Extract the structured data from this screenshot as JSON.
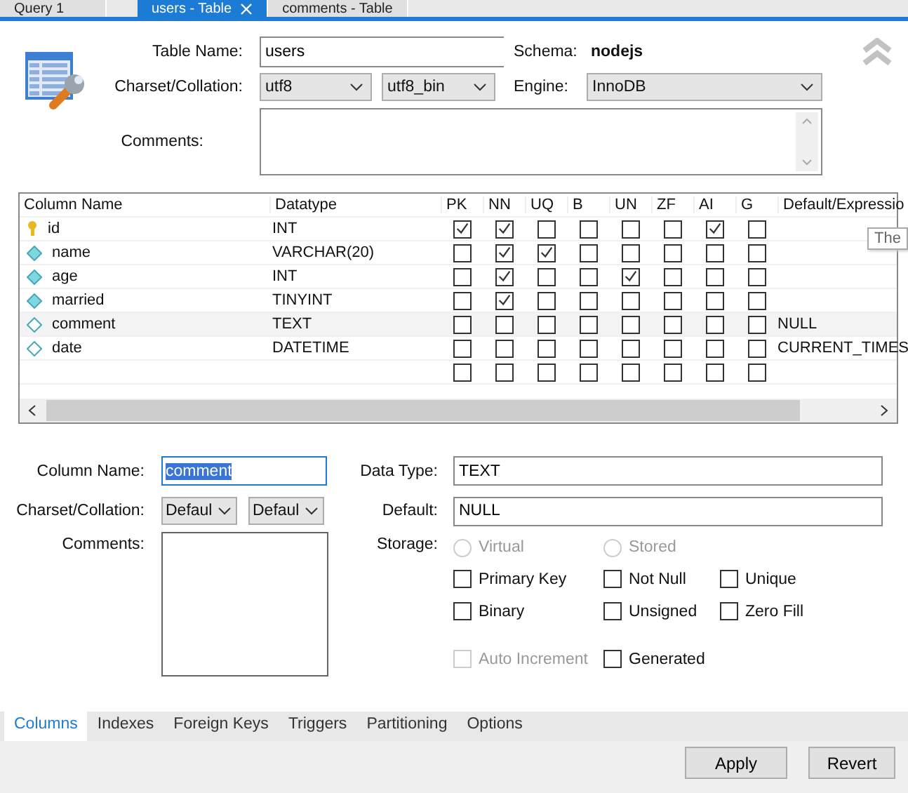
{
  "tabs": [
    {
      "label": "Query 1",
      "selected": false,
      "closable": false
    },
    {
      "label": "users - Table",
      "selected": true,
      "closable": true
    },
    {
      "label": "comments - Table",
      "selected": false,
      "closable": false
    }
  ],
  "table_form": {
    "table_name_label": "Table Name:",
    "table_name": "users",
    "schema_label": "Schema:",
    "schema": "nodejs",
    "charset_label": "Charset/Collation:",
    "charset": "utf8",
    "collation": "utf8_bin",
    "engine_label": "Engine:",
    "engine": "InnoDB",
    "comments_label": "Comments:"
  },
  "grid": {
    "columns": [
      "Column Name",
      "Datatype",
      "PK",
      "NN",
      "UQ",
      "B",
      "UN",
      "ZF",
      "AI",
      "G",
      "Default/Expressio"
    ],
    "rows": [
      {
        "kind": "key",
        "name": "id",
        "datatype": "INT",
        "flags": [
          true,
          true,
          false,
          false,
          false,
          false,
          true,
          false
        ],
        "selected": false
      },
      {
        "kind": "required",
        "name": "name",
        "datatype": "VARCHAR(20)",
        "flags": [
          false,
          true,
          true,
          false,
          false,
          false,
          false,
          false
        ],
        "selected": false
      },
      {
        "kind": "required",
        "name": "age",
        "datatype": "INT",
        "flags": [
          false,
          true,
          false,
          false,
          true,
          false,
          false,
          false
        ],
        "selected": false
      },
      {
        "kind": "required",
        "name": "married",
        "datatype": "TINYINT",
        "flags": [
          false,
          true,
          false,
          false,
          false,
          false,
          false,
          false
        ],
        "selected": false
      },
      {
        "kind": "optional",
        "name": "comment",
        "datatype": "TEXT",
        "flags": [
          false,
          false,
          false,
          false,
          false,
          false,
          false,
          false
        ],
        "default": "NULL",
        "selected": true
      },
      {
        "kind": "optional",
        "name": "date",
        "datatype": "DATETIME",
        "flags": [
          false,
          false,
          false,
          false,
          false,
          false,
          false,
          false
        ],
        "default": "CURRENT_TIMES",
        "selected": false
      },
      {
        "kind": "new",
        "flags": [
          false,
          false,
          false,
          false,
          false,
          false,
          false,
          false
        ],
        "selected": false
      }
    ]
  },
  "tooltip": {
    "text": "The"
  },
  "column_editor": {
    "column_name_label": "Column Name:",
    "column_name": "comment",
    "column_name_highlighted": true,
    "charset_label": "Charset/Collation:",
    "charset": "Defaul",
    "collation": "Defaul",
    "comments_label": "Comments:",
    "data_type_label": "Data Type:",
    "data_type": "TEXT",
    "default_label": "Default:",
    "default": "NULL",
    "storage_label": "Storage:",
    "storage_options": [
      {
        "label": "Virtual",
        "selected": false,
        "disabled": true
      },
      {
        "label": "Stored",
        "selected": false,
        "disabled": true
      }
    ],
    "options": [
      {
        "label": "Primary Key",
        "checked": false,
        "disabled": false
      },
      {
        "label": "Not Null",
        "checked": false,
        "disabled": false
      },
      {
        "label": "Unique",
        "checked": false,
        "disabled": false
      },
      {
        "label": "Binary",
        "checked": false,
        "disabled": false
      },
      {
        "label": "Unsigned",
        "checked": false,
        "disabled": false
      },
      {
        "label": "Zero Fill",
        "checked": false,
        "disabled": false
      },
      {
        "label": "Auto Increment",
        "checked": false,
        "disabled": true
      },
      {
        "label": "Generated",
        "checked": false,
        "disabled": false
      }
    ]
  },
  "bottom_tabs": [
    {
      "label": "Columns",
      "selected": true
    },
    {
      "label": "Indexes",
      "selected": false
    },
    {
      "label": "Foreign Keys",
      "selected": false
    },
    {
      "label": "Triggers",
      "selected": false
    },
    {
      "label": "Partitioning",
      "selected": false
    },
    {
      "label": "Options",
      "selected": false
    }
  ],
  "buttons": [
    "Apply",
    "Revert"
  ]
}
